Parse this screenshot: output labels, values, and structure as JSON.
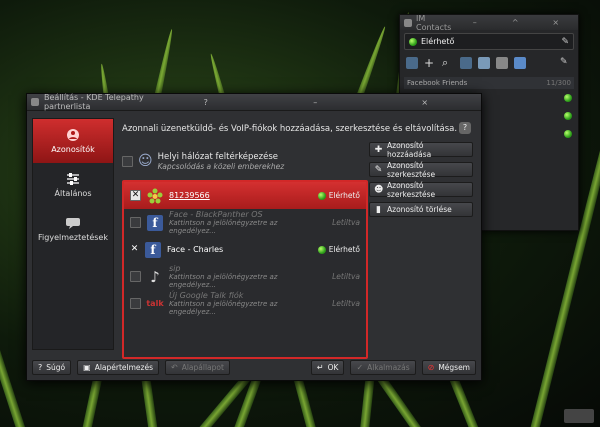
{
  "im": {
    "title": "IM Contacts",
    "status": "Elérhető",
    "group": {
      "label": "Facebook Friends",
      "count": "11/300"
    }
  },
  "dialog": {
    "title": "Beállítás - KDE Telepathy partnerlista",
    "heading": "Azonnali üzenetküldő- és VoIP-fiókok hozzáadása, szerkesztése és eltávolítása.",
    "sidebar": [
      {
        "label": "Azonosítók",
        "icon": "accounts-icon"
      },
      {
        "label": "Általános",
        "icon": "general-icon"
      },
      {
        "label": "Figyelmeztetések",
        "icon": "notifications-icon"
      }
    ],
    "local": {
      "title": "Helyi hálózat feltérképezése",
      "subtitle": "Kapcsolódás a közeli emberekhez"
    },
    "accounts": [
      {
        "name": "81239566",
        "sub": "",
        "status": "Elérhető",
        "checked": true,
        "enabled": true,
        "selected": true,
        "logo": "icq"
      },
      {
        "name": "Face - BlackPanther OS",
        "sub": "Kattintson a jelölőnégyzetre az engedélyez...",
        "status": "Letiltva",
        "checked": false,
        "enabled": false,
        "selected": false,
        "logo": "facebook"
      },
      {
        "name": "Face - Charles",
        "sub": "",
        "status": "Elérhető",
        "checked": true,
        "enabled": true,
        "selected": false,
        "logo": "facebook"
      },
      {
        "name": "sip",
        "sub": "Kattintson a jelölőnégyzetre az engedélyez...",
        "status": "Letiltva",
        "checked": false,
        "enabled": false,
        "selected": false,
        "logo": "sip"
      },
      {
        "name": "Új Google Talk fiók",
        "sub": "Kattintson a jelölőnégyzetre az engedélyez...",
        "status": "Letiltva",
        "checked": false,
        "enabled": false,
        "selected": false,
        "logo": "talk"
      }
    ],
    "buttons": {
      "add": "Azonosító hozzáadása",
      "edit": "Azonosító szerkesztése",
      "edit2": "Azonosító szerkesztése",
      "remove": "Azonosító törlése"
    },
    "bottom": {
      "help": "Súgó",
      "defaults": "Alapértelmezés",
      "reset": "Alapállapot",
      "ok": "OK",
      "apply": "Alkalmazás",
      "cancel": "Mégsem"
    }
  }
}
